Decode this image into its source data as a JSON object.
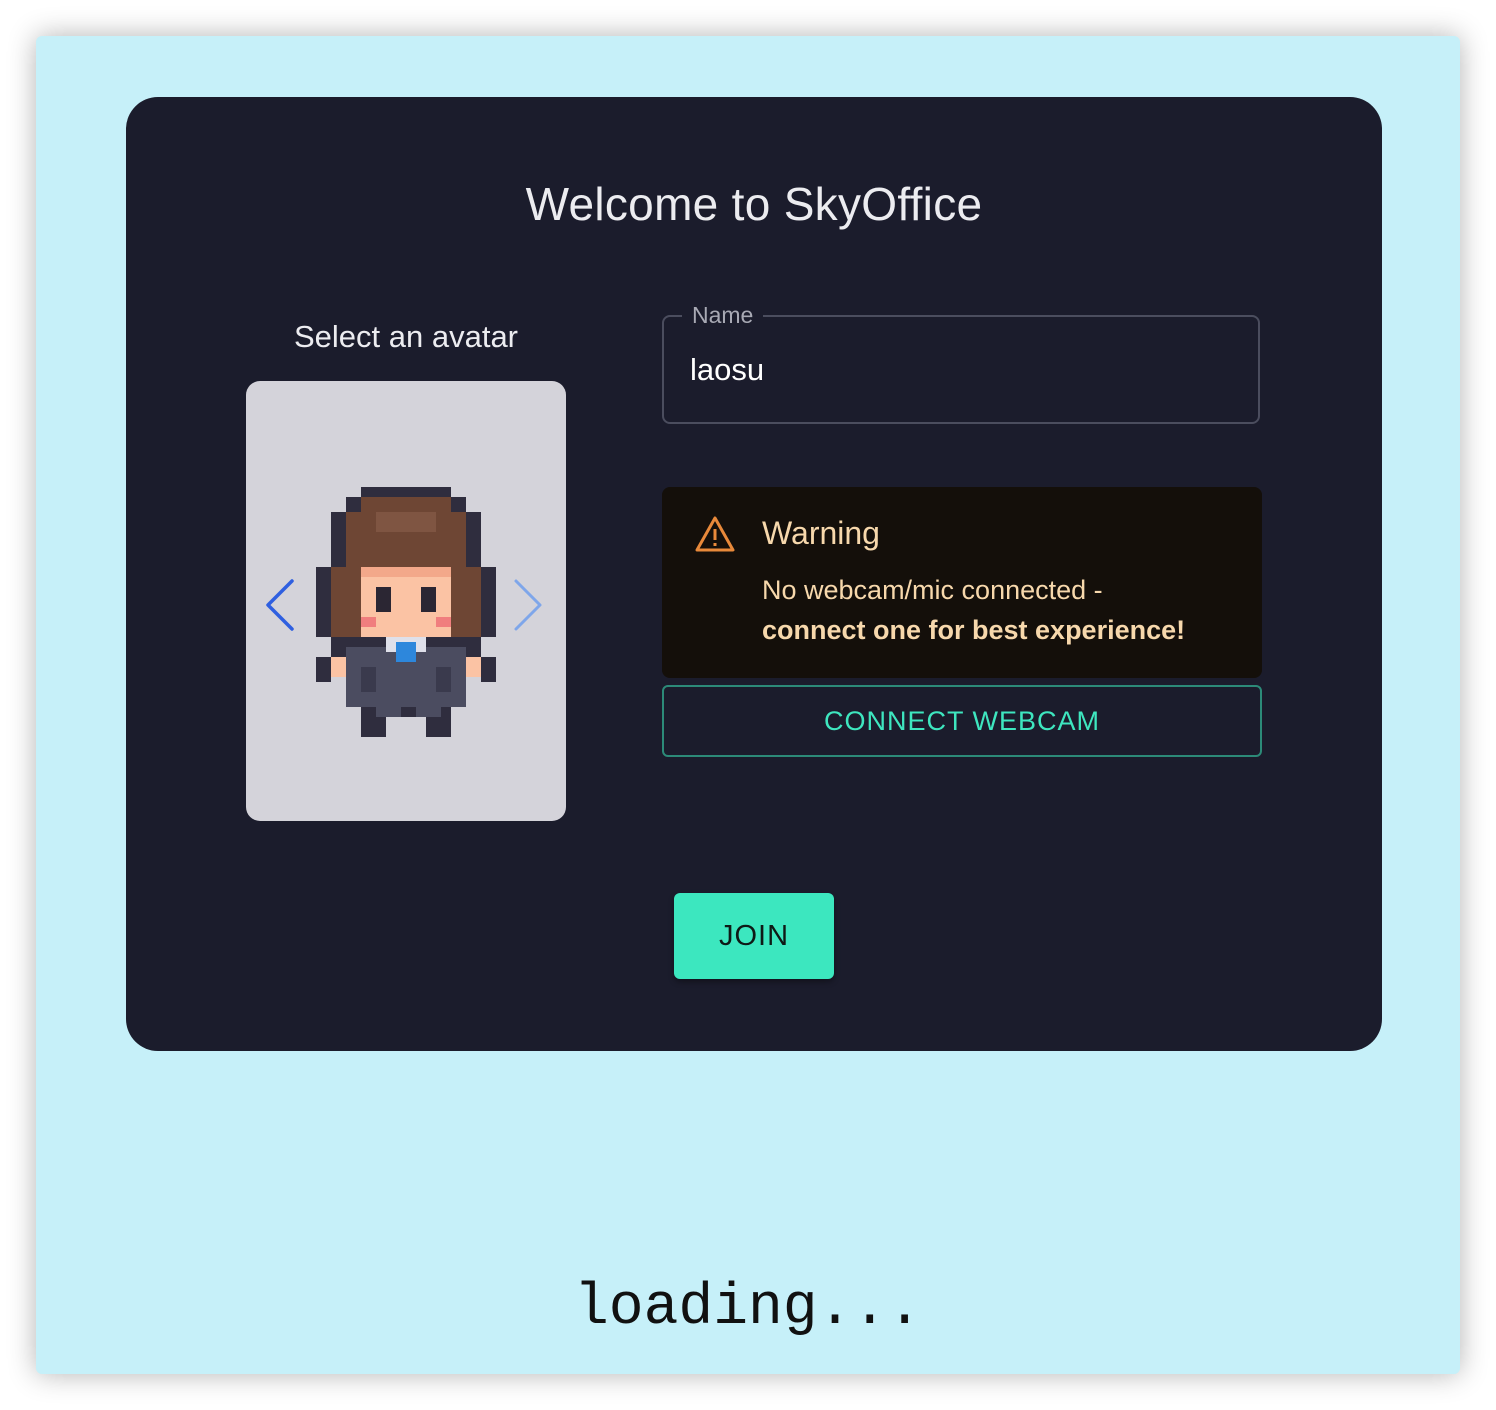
{
  "dialog": {
    "title": "Welcome to SkyOffice"
  },
  "avatar": {
    "label": "Select an avatar",
    "prev_icon": "chevron-left-icon",
    "next_icon": "chevron-right-icon",
    "sprite_icon": "pixel-character-avatar"
  },
  "name_field": {
    "label": "Name",
    "value": "laosu"
  },
  "warning": {
    "icon": "warning-triangle-icon",
    "title": "Warning",
    "line1": "No webcam/mic connected -",
    "line2": "connect one for best experience!"
  },
  "buttons": {
    "connect_webcam": "CONNECT WEBCAM",
    "join": "JOIN"
  },
  "status": {
    "loading": "loading..."
  },
  "colors": {
    "background": "#c6f0f9",
    "dialog": "#1b1c2c",
    "accent": "#3ce7bf",
    "warning_text": "#f7d8ac",
    "warning_icon": "#e8893a"
  }
}
